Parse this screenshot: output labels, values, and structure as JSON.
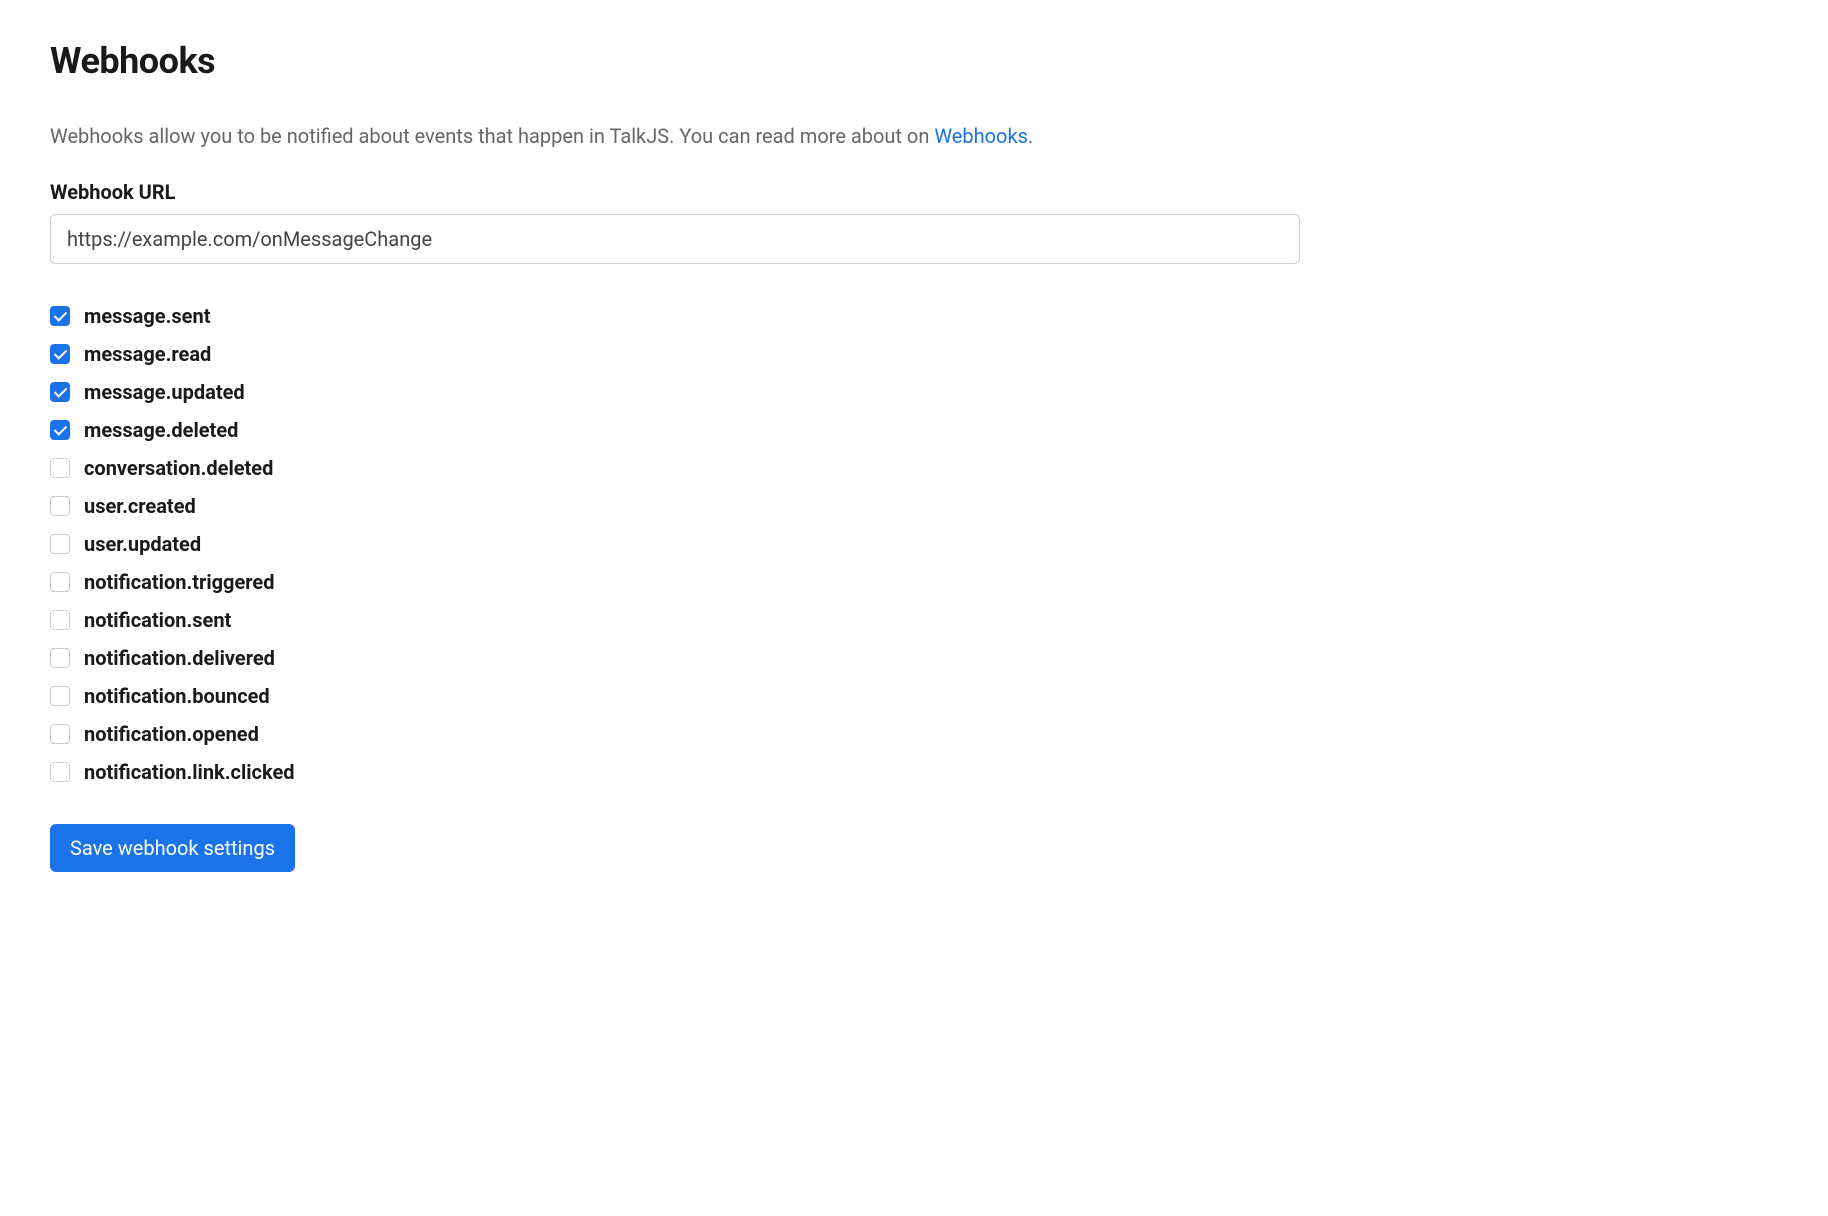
{
  "header": {
    "title": "Webhooks"
  },
  "description": {
    "text_before": "Webhooks allow you to be notified about events that happen in TalkJS. You can read more about on ",
    "link_text": "Webhooks",
    "text_after": "."
  },
  "url_field": {
    "label": "Webhook URL",
    "value": "https://example.com/onMessageChange"
  },
  "events": [
    {
      "label": "message.sent",
      "checked": true
    },
    {
      "label": "message.read",
      "checked": true
    },
    {
      "label": "message.updated",
      "checked": true
    },
    {
      "label": "message.deleted",
      "checked": true
    },
    {
      "label": "conversation.deleted",
      "checked": false
    },
    {
      "label": "user.created",
      "checked": false
    },
    {
      "label": "user.updated",
      "checked": false
    },
    {
      "label": "notification.triggered",
      "checked": false
    },
    {
      "label": "notification.sent",
      "checked": false
    },
    {
      "label": "notification.delivered",
      "checked": false
    },
    {
      "label": "notification.bounced",
      "checked": false
    },
    {
      "label": "notification.opened",
      "checked": false
    },
    {
      "label": "notification.link.clicked",
      "checked": false
    }
  ],
  "actions": {
    "save_label": "Save webhook settings"
  }
}
